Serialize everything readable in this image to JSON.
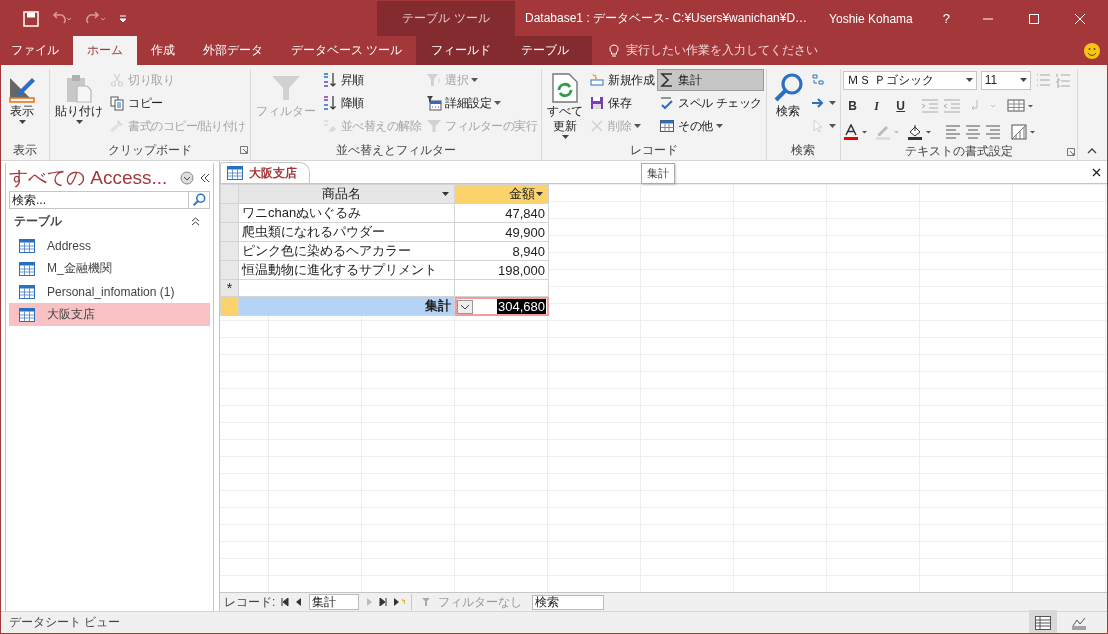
{
  "title_bar": {
    "contextual_group": "テーブル ツール",
    "title": "Database1 : データベース- C:¥Users¥wanichan¥D…",
    "user": "Yoshie Kohama",
    "help": "?"
  },
  "ribbon_tabs": [
    {
      "label": "ファイル",
      "selected": false,
      "contextual": false
    },
    {
      "label": "ホーム",
      "selected": true,
      "contextual": false
    },
    {
      "label": "作成",
      "selected": false,
      "contextual": false
    },
    {
      "label": "外部データ",
      "selected": false,
      "contextual": false
    },
    {
      "label": "データベース ツール",
      "selected": false,
      "contextual": false
    },
    {
      "label": "フィールド",
      "selected": false,
      "contextual": true
    },
    {
      "label": "テーブル",
      "selected": false,
      "contextual": true
    }
  ],
  "tell_me": "実行したい作業を入力してください",
  "ribbon_groups": [
    {
      "label": "表示",
      "launcher": false,
      "columns": [
        [
          {
            "lines": [
              "表示"
            ],
            "kind": "large",
            "disabled": false,
            "dropdown": true,
            "pressed": false
          }
        ]
      ]
    },
    {
      "label": "クリップボード",
      "launcher": true,
      "columns": [
        [
          {
            "lines": [
              "貼り付け"
            ],
            "kind": "large",
            "disabled": false,
            "dropdown": true,
            "pressed": false
          }
        ],
        [
          {
            "label": "切り取り",
            "kind": "small",
            "disabled": true,
            "dropdown": false,
            "pressed": false
          },
          {
            "label": "コピー",
            "kind": "small",
            "disabled": false,
            "dropdown": false,
            "pressed": false
          },
          {
            "label": "書式のコピー/貼り付け",
            "kind": "small",
            "disabled": true,
            "dropdown": false,
            "pressed": false
          }
        ]
      ]
    },
    {
      "label": "並べ替えとフィルター",
      "launcher": false,
      "columns": [
        [
          {
            "lines": [
              "フィルター"
            ],
            "kind": "large",
            "disabled": true,
            "dropdown": false,
            "pressed": false
          }
        ],
        [
          {
            "label": "昇順",
            "kind": "small",
            "disabled": false,
            "dropdown": false,
            "pressed": false
          },
          {
            "label": "降順",
            "kind": "small",
            "disabled": false,
            "dropdown": false,
            "pressed": false
          },
          {
            "label": "並べ替えの解除",
            "kind": "small",
            "disabled": true,
            "dropdown": false,
            "pressed": false
          }
        ],
        [
          {
            "label": "選択",
            "kind": "small",
            "disabled": true,
            "dropdown": true,
            "pressed": false
          },
          {
            "label": "詳細設定",
            "kind": "small",
            "disabled": false,
            "dropdown": true,
            "pressed": false
          },
          {
            "label": "フィルターの実行",
            "kind": "small",
            "disabled": true,
            "dropdown": false,
            "pressed": false
          }
        ]
      ]
    },
    {
      "label": "レコード",
      "launcher": false,
      "columns": [
        [
          {
            "lines": [
              "すべて",
              "更新"
            ],
            "kind": "large",
            "disabled": false,
            "dropdown": true,
            "pressed": false
          }
        ],
        [
          {
            "label": "新規作成",
            "kind": "small",
            "disabled": false,
            "dropdown": false,
            "pressed": false
          },
          {
            "label": "保存",
            "kind": "small",
            "disabled": false,
            "dropdown": false,
            "pressed": false
          },
          {
            "label": "削除",
            "kind": "small",
            "disabled": true,
            "dropdown": true,
            "pressed": false
          }
        ],
        [
          {
            "label": "集計",
            "kind": "small",
            "disabled": false,
            "dropdown": false,
            "pressed": true
          },
          {
            "label": "スペル チェック",
            "kind": "small",
            "disabled": false,
            "dropdown": false,
            "pressed": false
          },
          {
            "label": "その他",
            "kind": "small",
            "disabled": false,
            "dropdown": true,
            "pressed": false
          }
        ]
      ]
    },
    {
      "label": "検索",
      "launcher": false,
      "columns": [
        [
          {
            "lines": [
              "検索"
            ],
            "kind": "large",
            "disabled": false,
            "dropdown": false,
            "pressed": false
          }
        ],
        [
          {
            "kind": "small",
            "disabled": false,
            "dropdown": false,
            "pressed": false
          },
          {
            "kind": "small",
            "disabled": false,
            "dropdown": true,
            "pressed": false
          },
          {
            "kind": "small",
            "disabled": true,
            "dropdown": true,
            "pressed": false
          }
        ]
      ]
    }
  ],
  "text_formatting": {
    "label": "テキストの書式設定",
    "font_name": "ＭＳ Ｐゴシック",
    "font_size": "11",
    "format_buttons": [
      "B",
      "I",
      "U"
    ]
  },
  "tooltip": "集計",
  "navigation_pane": {
    "title": "すべての Access...",
    "search_placeholder": "検索...",
    "section": "テーブル",
    "items": [
      {
        "label": "Address",
        "selected": false
      },
      {
        "label": "M_金融機関",
        "selected": false
      },
      {
        "label": "Personal_infomation (1)",
        "selected": false
      },
      {
        "label": "大阪支店",
        "selected": true
      }
    ]
  },
  "document_tab": "大阪支店",
  "datasheet": {
    "columns": [
      {
        "label": "商品名",
        "selected": false
      },
      {
        "label": "金額",
        "selected": true
      }
    ],
    "rows": [
      [
        "ワニchanぬいぐるみ",
        "47,840"
      ],
      [
        "爬虫類になれるパウダー",
        "49,900"
      ],
      [
        "ピンク色に染めるヘアカラー",
        "8,940"
      ],
      [
        "恒温動物に進化するサプリメント",
        "198,000"
      ]
    ],
    "new_row_marker": "*",
    "total_row": {
      "label": "集計",
      "value": "304,680",
      "selected": true
    }
  },
  "record_navigator": {
    "label": "レコード:",
    "current": "集計",
    "filter": "フィルターなし",
    "search_placeholder": "検索"
  },
  "status_bar": {
    "text": "データシート ビュー"
  }
}
